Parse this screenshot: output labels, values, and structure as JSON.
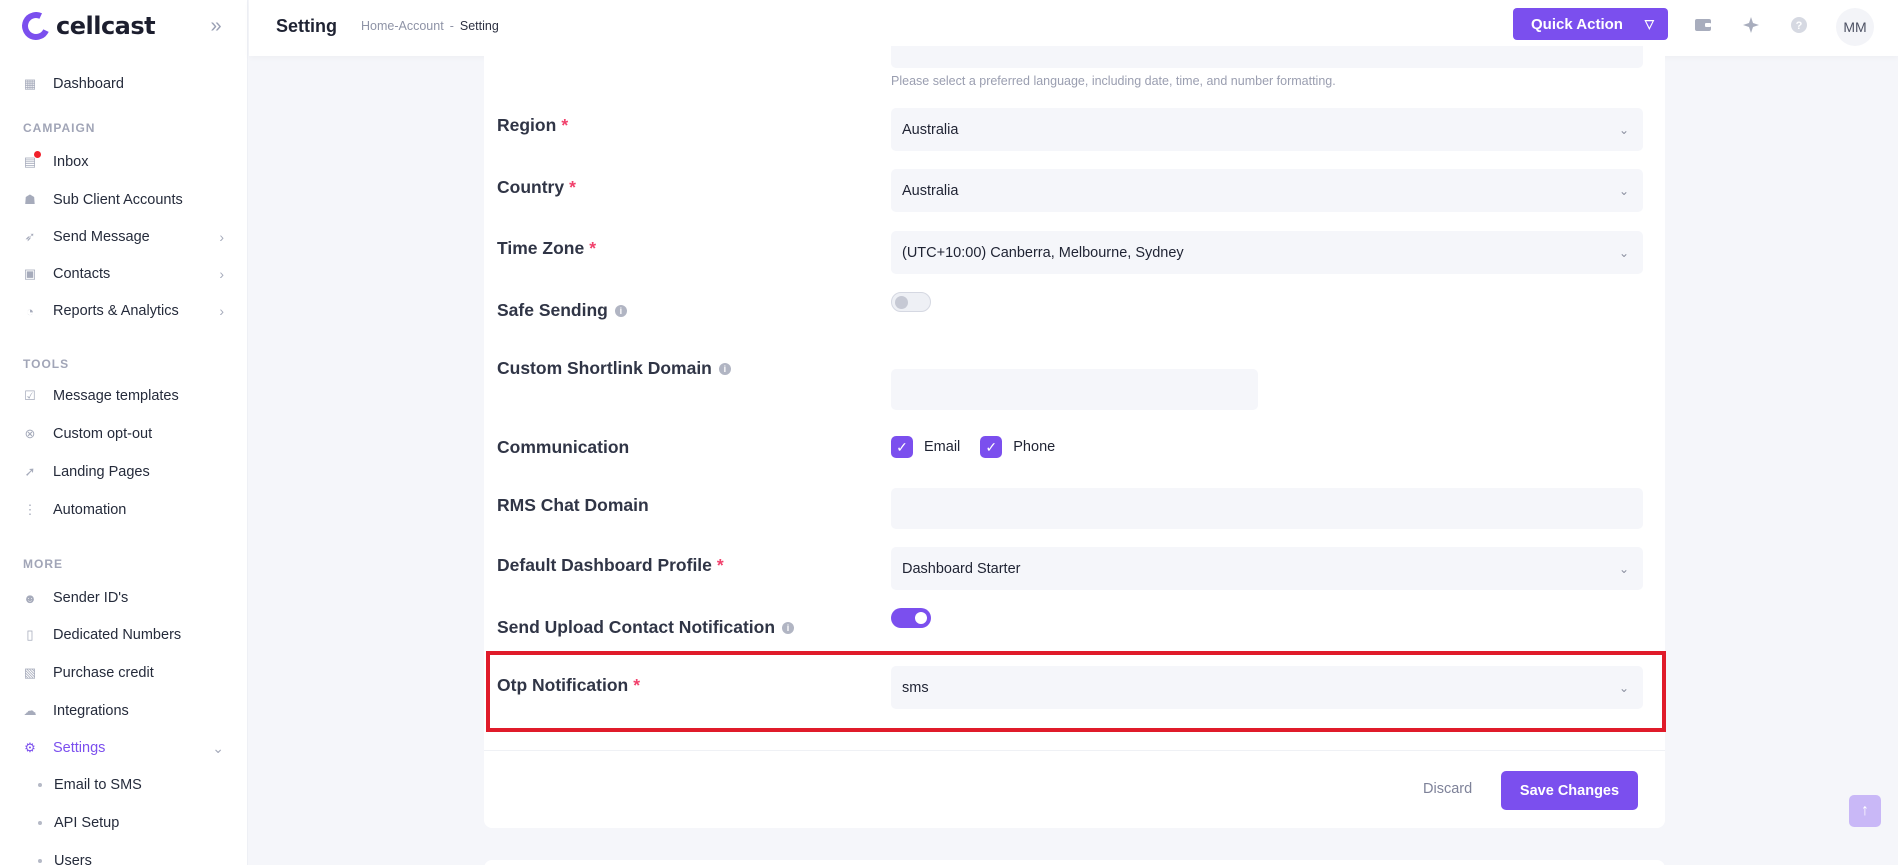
{
  "brand": {
    "name": "cellcast"
  },
  "sidebar": {
    "sections": {
      "campaign": "CAMPAIGN",
      "tools": "TOOLS",
      "more": "MORE"
    },
    "items": {
      "dashboard": "Dashboard",
      "inbox": "Inbox",
      "sub_client": "Sub Client Accounts",
      "send_message": "Send Message",
      "contacts": "Contacts",
      "reports": "Reports & Analytics",
      "message_templates": "Message templates",
      "custom_optout": "Custom opt-out",
      "landing_pages": "Landing Pages",
      "automation": "Automation",
      "sender_ids": "Sender ID's",
      "dedicated_numbers": "Dedicated Numbers",
      "purchase_credit": "Purchase credit",
      "integrations": "Integrations",
      "settings": "Settings"
    },
    "settings_sub": {
      "email_to_sms": "Email to SMS",
      "api_setup": "API Setup",
      "users": "Users"
    }
  },
  "header": {
    "title": "Setting",
    "breadcrumb": {
      "home": "Home",
      "separator1": "-",
      "account": "Account",
      "separator2": "-",
      "current": "Setting"
    },
    "quick_action": "Quick Action",
    "avatar_initials": "MM"
  },
  "form": {
    "language_help": "Please select a preferred language, including date, time, and number formatting.",
    "region": {
      "label": "Region",
      "value": "Australia"
    },
    "country": {
      "label": "Country",
      "value": "Australia"
    },
    "time_zone": {
      "label": "Time Zone",
      "value": "(UTC+10:00) Canberra, Melbourne, Sydney"
    },
    "safe_sending": {
      "label": "Safe Sending",
      "enabled": false
    },
    "shortlink": {
      "label": "Custom Shortlink Domain",
      "value": ""
    },
    "communication": {
      "label": "Communication",
      "email": "Email",
      "phone": "Phone",
      "email_checked": true,
      "phone_checked": true
    },
    "rms_chat": {
      "label": "RMS Chat Domain",
      "value": ""
    },
    "dashboard_profile": {
      "label": "Default Dashboard Profile",
      "value": "Dashboard Starter"
    },
    "upload_notification": {
      "label": "Send Upload Contact Notification",
      "enabled": true
    },
    "otp_notification": {
      "label": "Otp Notification",
      "value": "sms"
    },
    "required_mark": "*",
    "info_mark": "i"
  },
  "actions": {
    "discard": "Discard",
    "save": "Save Changes"
  },
  "colors": {
    "accent": "#7b4fee",
    "highlight": "#e01b2a",
    "required": "#f1416c",
    "notification": "#f1212b"
  }
}
